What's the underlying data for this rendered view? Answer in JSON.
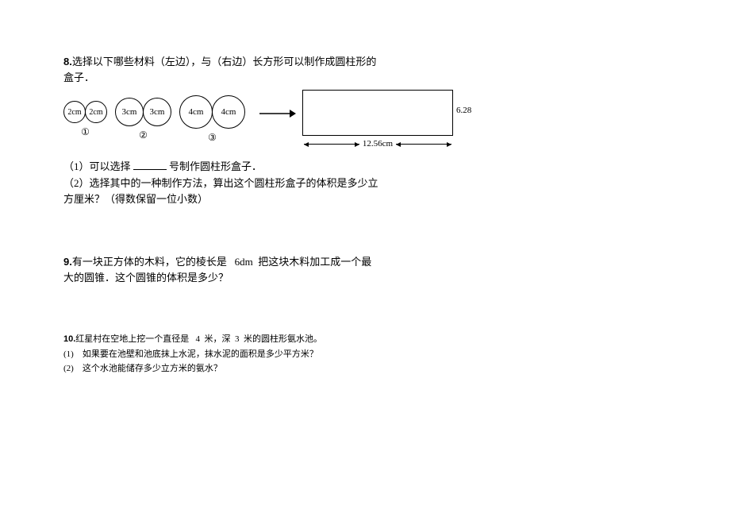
{
  "q8": {
    "num": "8.",
    "intro": "选择以下哪些材料（左边），与（右边）长方形可以制作成圆柱形的盒子．",
    "circles": {
      "opt1": {
        "r": "2cm",
        "label": "①"
      },
      "opt2": {
        "r": "3cm",
        "label": "②"
      },
      "opt3": {
        "r": "4cm",
        "label": "③"
      }
    },
    "rect": {
      "w": "12.56cm",
      "h": "6.28"
    },
    "sub1_a": "（1）可以选择 ",
    "sub1_b": " 号制作圆柱形盒子．",
    "sub2": "（2）选择其中的一种制作方法，算出这个圆柱形盒子的体积是多少立方厘米？（得数保留一位小数）"
  },
  "q9": {
    "num": "9.",
    "text_a": "有一块正方体的木料，它的棱长是",
    "val": "6dm",
    "text_b": "把这块木料加工成一个最大的圆锥．这个圆锥的体积是多少？"
  },
  "q10": {
    "num": "10.",
    "text_a": "红星村在空地上挖一个直径是",
    "v1": "4",
    "text_b": "米，深",
    "v2": "3",
    "text_c": "米的圆柱形氨水池。",
    "sub1": "(1)　如果要在池壁和池底抹上水泥，抹水泥的面积是多少平方米？",
    "sub2": "(2)　这个水池能储存多少立方米的氨水？"
  },
  "chart_data": {
    "type": "table",
    "title": "Problem 8 figure dimensions",
    "items": [
      {
        "option": "①",
        "circle_radius_cm": 2
      },
      {
        "option": "②",
        "circle_radius_cm": 3
      },
      {
        "option": "③",
        "circle_radius_cm": 4
      }
    ],
    "rectangle": {
      "width_cm": 12.56,
      "height_cm": 6.28
    }
  }
}
